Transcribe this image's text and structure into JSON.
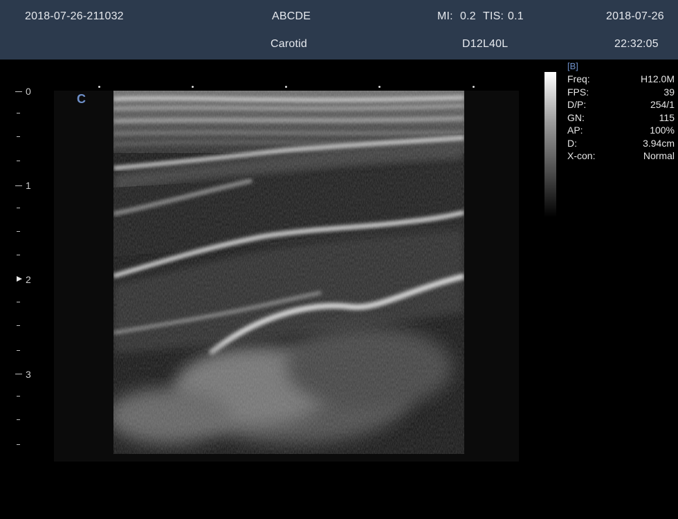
{
  "header": {
    "exam_id": "2018-07-26-211032",
    "patient_name": "ABCDE",
    "mi_label": "MI:",
    "mi_value": "0.2",
    "tis_label": "TIS:",
    "tis_value": "0.1",
    "date": "2018-07-26",
    "preset": "Carotid",
    "probe": "D12L40L",
    "time": "22:32:05"
  },
  "image": {
    "orientation_marker": "C"
  },
  "depth_scale": {
    "unit": "cm",
    "labels": [
      "0",
      "1",
      "2",
      "3"
    ],
    "focus_depth_cm": 2
  },
  "params": {
    "mode": "[B]",
    "rows": [
      {
        "label": "Freq:",
        "value": "H12.0M"
      },
      {
        "label": "FPS:",
        "value": "39"
      },
      {
        "label": "D/P:",
        "value": "254/1"
      },
      {
        "label": "GN:",
        "value": "115"
      },
      {
        "label": "AP:",
        "value": "100%"
      },
      {
        "label": "D:",
        "value": "3.94cm"
      },
      {
        "label": "X-con:",
        "value": "Normal"
      }
    ]
  }
}
